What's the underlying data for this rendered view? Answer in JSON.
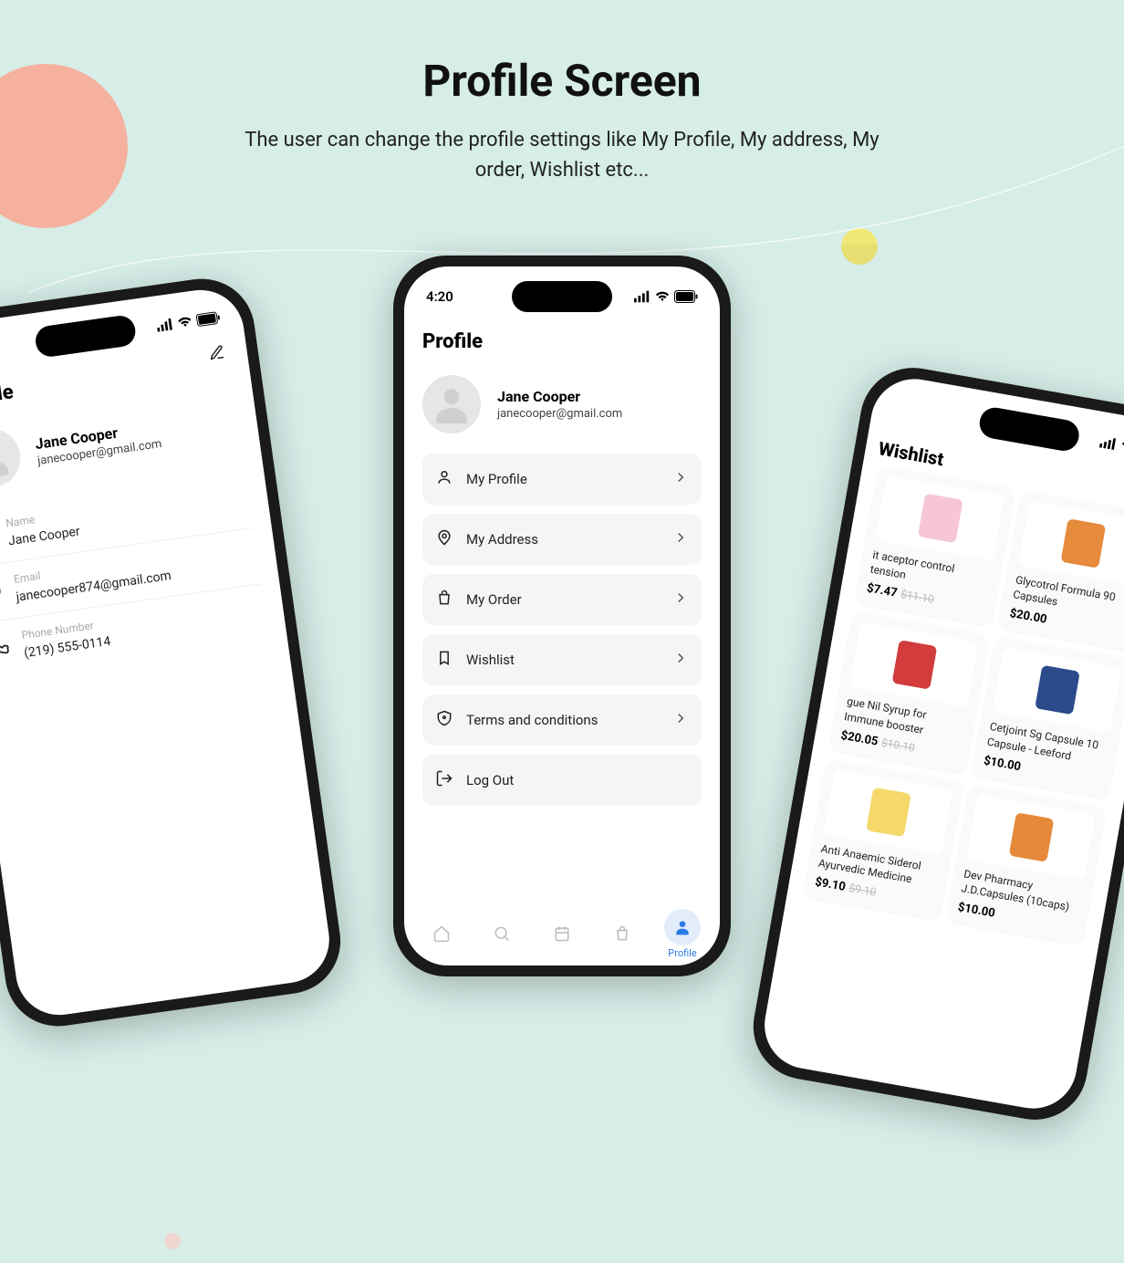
{
  "hero": {
    "title": "Profile Screen",
    "subtitle": "The user can change the profile settings like My Profile, My address, My order, Wishlist etc..."
  },
  "status_time": "4:20",
  "profile_main": {
    "title": "Profile",
    "name": "Jane Cooper",
    "email": "janecooper@gmail.com",
    "menu": [
      {
        "label": "My Profile"
      },
      {
        "label": "My Address"
      },
      {
        "label": "My Order"
      },
      {
        "label": "Wishlist"
      },
      {
        "label": "Terms and conditions"
      },
      {
        "label": "Log Out"
      }
    ],
    "nav_profile_label": "Profile"
  },
  "profile_edit": {
    "title": "Profile",
    "name": "Jane Cooper",
    "email": "janecooper@gmail.com",
    "fields": {
      "name_label": "Name",
      "name_value": "Jane Cooper",
      "email_label": "Email",
      "email_value": "janecooper874@gmail.com",
      "phone_label": "Phone Number",
      "phone_value": "(219) 555-0114"
    }
  },
  "wishlist": {
    "title": "Wishlist",
    "products": [
      {
        "title": "it aceptor control tension",
        "price": "$7.47",
        "old_price": "$11.10",
        "thumb_bg": "#f7c5d8"
      },
      {
        "title": "Glycotrol Formula 90 Capsules",
        "price": "$20.00",
        "old_price": "",
        "thumb_bg": "#e68a3c"
      },
      {
        "title": "gue Nil Syrup for Immune booster",
        "price": "$20.05",
        "old_price": "$10.10",
        "thumb_bg": "#d23c3c"
      },
      {
        "title": "Cetjoint Sg Capsule 10 Capsule - Leeford",
        "price": "$10.00",
        "old_price": "",
        "thumb_bg": "#2b4b8b"
      },
      {
        "title": "Anti Anaemic Siderol Ayurvedic Medicine",
        "price": "$9.10",
        "old_price": "$9.10",
        "thumb_bg": "#f5d96b"
      },
      {
        "title": "Dev Pharmacy J.D.Capsules (10caps)",
        "price": "$10.00",
        "old_price": "",
        "thumb_bg": "#e58a3a"
      }
    ]
  }
}
